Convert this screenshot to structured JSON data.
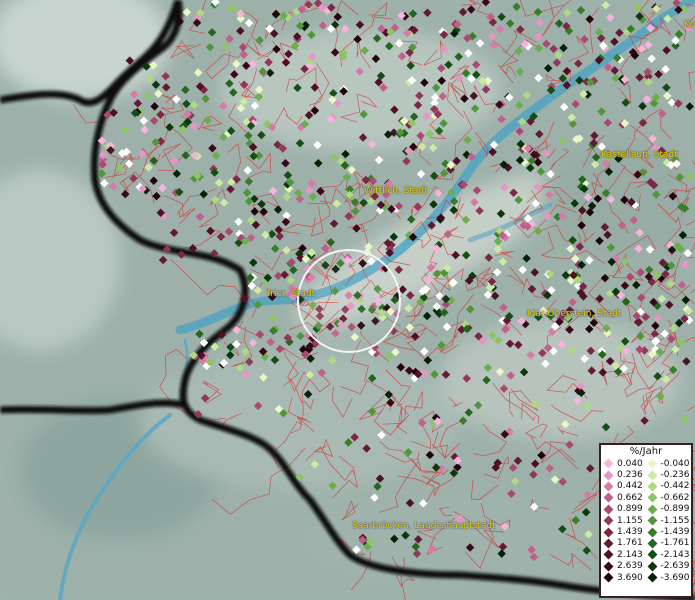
{
  "map": {
    "cities": [
      {
        "name": "Wittlich, Stadt"
      },
      {
        "name": "Trier, Stadt"
      },
      {
        "name": "Idar-Oberstein, Stadt"
      },
      {
        "name": "Kastellaun, Stadt"
      },
      {
        "name": "Saarbrücken, Landeshauptstadt"
      },
      {
        "name": "Ko"
      }
    ]
  },
  "legend": {
    "title": "%/Jahr",
    "positive": [
      {
        "label": "0.040",
        "color": "#f6b4dc"
      },
      {
        "label": "0.236",
        "color": "#e696c4"
      },
      {
        "label": "0.442",
        "color": "#d67aa8"
      },
      {
        "label": "0.662",
        "color": "#c2608c"
      },
      {
        "label": "0.899",
        "color": "#aa4a72"
      },
      {
        "label": "1.155",
        "color": "#92385a"
      },
      {
        "label": "1.439",
        "color": "#7a2844"
      },
      {
        "label": "1.761",
        "color": "#631a32"
      },
      {
        "label": "2.143",
        "color": "#4d1024"
      },
      {
        "label": "2.639",
        "color": "#380818"
      },
      {
        "label": "3.690",
        "color": "#22030c"
      }
    ],
    "negative": [
      {
        "label": "-0.040",
        "color": "#eaf7c4"
      },
      {
        "label": "-0.236",
        "color": "#cdeaa2"
      },
      {
        "label": "-0.442",
        "color": "#aed982"
      },
      {
        "label": "-0.662",
        "color": "#8cc466"
      },
      {
        "label": "-0.899",
        "color": "#6cae4e"
      },
      {
        "label": "-1.155",
        "color": "#50963a"
      },
      {
        "label": "-1.439",
        "color": "#387e2a"
      },
      {
        "label": "-1.761",
        "color": "#24661e"
      },
      {
        "label": "-2.143",
        "color": "#154e14"
      },
      {
        "label": "-2.639",
        "color": "#0a380c"
      },
      {
        "label": "-3.690",
        "color": "#032206"
      }
    ]
  }
}
